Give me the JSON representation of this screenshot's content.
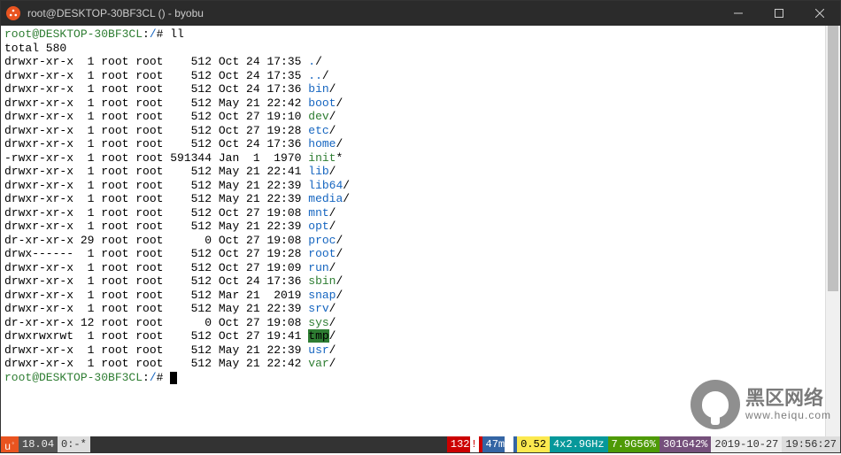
{
  "window": {
    "title": "root@DESKTOP-30BF3CL () - byobu"
  },
  "terminal": {
    "prompt_user_host": "root@DESKTOP-30BF3CL",
    "prompt_sep": ":",
    "prompt_path": "/",
    "prompt_suffix": "# ",
    "command": "ll",
    "total_line": "total 580",
    "listing": [
      {
        "perm": "drwxr-xr-x",
        "links": "1",
        "owner": "root",
        "group": "root",
        "size": "512",
        "date": "Oct 24 17:35",
        "name": ".",
        "name_color": "blue",
        "suffix": "/",
        "suffix_color": ""
      },
      {
        "perm": "drwxr-xr-x",
        "links": "1",
        "owner": "root",
        "group": "root",
        "size": "512",
        "date": "Oct 24 17:35",
        "name": "..",
        "name_color": "blue",
        "suffix": "/",
        "suffix_color": ""
      },
      {
        "perm": "drwxr-xr-x",
        "links": "1",
        "owner": "root",
        "group": "root",
        "size": "512",
        "date": "Oct 24 17:36",
        "name": "bin",
        "name_color": "blue",
        "suffix": "/",
        "suffix_color": ""
      },
      {
        "perm": "drwxr-xr-x",
        "links": "1",
        "owner": "root",
        "group": "root",
        "size": "512",
        "date": "May 21 22:42",
        "name": "boot",
        "name_color": "blue",
        "suffix": "/",
        "suffix_color": ""
      },
      {
        "perm": "drwxr-xr-x",
        "links": "1",
        "owner": "root",
        "group": "root",
        "size": "512",
        "date": "Oct 27 19:10",
        "name": "dev",
        "name_color": "green",
        "suffix": "/",
        "suffix_color": ""
      },
      {
        "perm": "drwxr-xr-x",
        "links": "1",
        "owner": "root",
        "group": "root",
        "size": "512",
        "date": "Oct 27 19:28",
        "name": "etc",
        "name_color": "blue",
        "suffix": "/",
        "suffix_color": ""
      },
      {
        "perm": "drwxr-xr-x",
        "links": "1",
        "owner": "root",
        "group": "root",
        "size": "512",
        "date": "Oct 24 17:36",
        "name": "home",
        "name_color": "blue",
        "suffix": "/",
        "suffix_color": ""
      },
      {
        "perm": "-rwxr-xr-x",
        "links": "1",
        "owner": "root",
        "group": "root",
        "size": "591344",
        "date": "Jan  1  1970",
        "name": "init",
        "name_color": "green",
        "suffix": "*",
        "suffix_color": ""
      },
      {
        "perm": "drwxr-xr-x",
        "links": "1",
        "owner": "root",
        "group": "root",
        "size": "512",
        "date": "May 21 22:41",
        "name": "lib",
        "name_color": "blue",
        "suffix": "/",
        "suffix_color": ""
      },
      {
        "perm": "drwxr-xr-x",
        "links": "1",
        "owner": "root",
        "group": "root",
        "size": "512",
        "date": "May 21 22:39",
        "name": "lib64",
        "name_color": "blue",
        "suffix": "/",
        "suffix_color": ""
      },
      {
        "perm": "drwxr-xr-x",
        "links": "1",
        "owner": "root",
        "group": "root",
        "size": "512",
        "date": "May 21 22:39",
        "name": "media",
        "name_color": "blue",
        "suffix": "/",
        "suffix_color": ""
      },
      {
        "perm": "drwxr-xr-x",
        "links": "1",
        "owner": "root",
        "group": "root",
        "size": "512",
        "date": "Oct 27 19:08",
        "name": "mnt",
        "name_color": "blue",
        "suffix": "/",
        "suffix_color": ""
      },
      {
        "perm": "drwxr-xr-x",
        "links": "1",
        "owner": "root",
        "group": "root",
        "size": "512",
        "date": "May 21 22:39",
        "name": "opt",
        "name_color": "blue",
        "suffix": "/",
        "suffix_color": ""
      },
      {
        "perm": "dr-xr-xr-x",
        "links": "29",
        "owner": "root",
        "group": "root",
        "size": "0",
        "date": "Oct 27 19:08",
        "name": "proc",
        "name_color": "blue",
        "suffix": "/",
        "suffix_color": ""
      },
      {
        "perm": "drwx------",
        "links": "1",
        "owner": "root",
        "group": "root",
        "size": "512",
        "date": "Oct 27 19:28",
        "name": "root",
        "name_color": "blue",
        "suffix": "/",
        "suffix_color": ""
      },
      {
        "perm": "drwxr-xr-x",
        "links": "1",
        "owner": "root",
        "group": "root",
        "size": "512",
        "date": "Oct 27 19:09",
        "name": "run",
        "name_color": "blue",
        "suffix": "/",
        "suffix_color": ""
      },
      {
        "perm": "drwxr-xr-x",
        "links": "1",
        "owner": "root",
        "group": "root",
        "size": "512",
        "date": "Oct 24 17:36",
        "name": "sbin",
        "name_color": "green",
        "suffix": "/",
        "suffix_color": ""
      },
      {
        "perm": "drwxr-xr-x",
        "links": "1",
        "owner": "root",
        "group": "root",
        "size": "512",
        "date": "Mar 21  2019",
        "name": "snap",
        "name_color": "blue",
        "suffix": "/",
        "suffix_color": ""
      },
      {
        "perm": "drwxr-xr-x",
        "links": "1",
        "owner": "root",
        "group": "root",
        "size": "512",
        "date": "May 21 22:39",
        "name": "srv",
        "name_color": "blue",
        "suffix": "/",
        "suffix_color": ""
      },
      {
        "perm": "dr-xr-xr-x",
        "links": "12",
        "owner": "root",
        "group": "root",
        "size": "0",
        "date": "Oct 27 19:08",
        "name": "sys",
        "name_color": "green",
        "suffix": "/",
        "suffix_color": ""
      },
      {
        "perm": "drwxrwxrwt",
        "links": "1",
        "owner": "root",
        "group": "root",
        "size": "512",
        "date": "Oct 27 19:41",
        "name": "tmp",
        "name_color": "tmp",
        "suffix": "/",
        "suffix_color": ""
      },
      {
        "perm": "drwxr-xr-x",
        "links": "1",
        "owner": "root",
        "group": "root",
        "size": "512",
        "date": "May 21 22:39",
        "name": "usr",
        "name_color": "blue",
        "suffix": "/",
        "suffix_color": ""
      },
      {
        "perm": "drwxr-xr-x",
        "links": "1",
        "owner": "root",
        "group": "root",
        "size": "512",
        "date": "May 21 22:42",
        "name": "var",
        "name_color": "green",
        "suffix": "/",
        "suffix_color": ""
      }
    ]
  },
  "statusbar": {
    "logo": "u",
    "version": "18.04",
    "session": "0:-*",
    "net": "132",
    "swap": "47m",
    "load": "0.52",
    "cpu": "4x2.9GHz",
    "mem": "7.9G56%",
    "disk": "301G42%",
    "date": "2019-10-27",
    "time": "19:56:27"
  },
  "watermark": {
    "cn": "黑区网络",
    "url": "www.heiqu.com"
  }
}
